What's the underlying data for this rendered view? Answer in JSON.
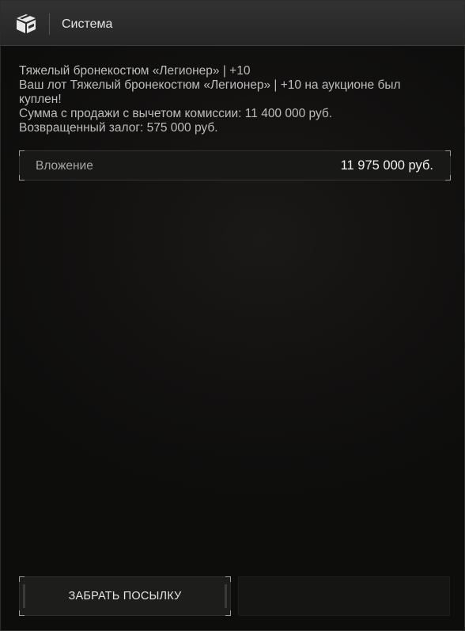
{
  "header": {
    "title": "Система",
    "icon": "package-box-icon"
  },
  "message": {
    "lines": [
      "Тяжелый бронекостюм «Легионер» | +10",
      "Ваш лот Тяжелый бронекостюм «Легионер» | +10 на аукционе был куплен!",
      "Сумма с продажи с вычетом комиссии: 11 400 000 руб.",
      "Возвращенный залог: 575 000 руб."
    ]
  },
  "investment": {
    "label": "Вложение",
    "value": "11 975 000 руб."
  },
  "actions": {
    "collect_label": "ЗАБРАТЬ ПОСЫЛКУ"
  },
  "colors": {
    "background": "#0d0d0c",
    "header": "#2b2b2b",
    "text": "#c9c9c7",
    "value_text": "#f0f0ee"
  }
}
